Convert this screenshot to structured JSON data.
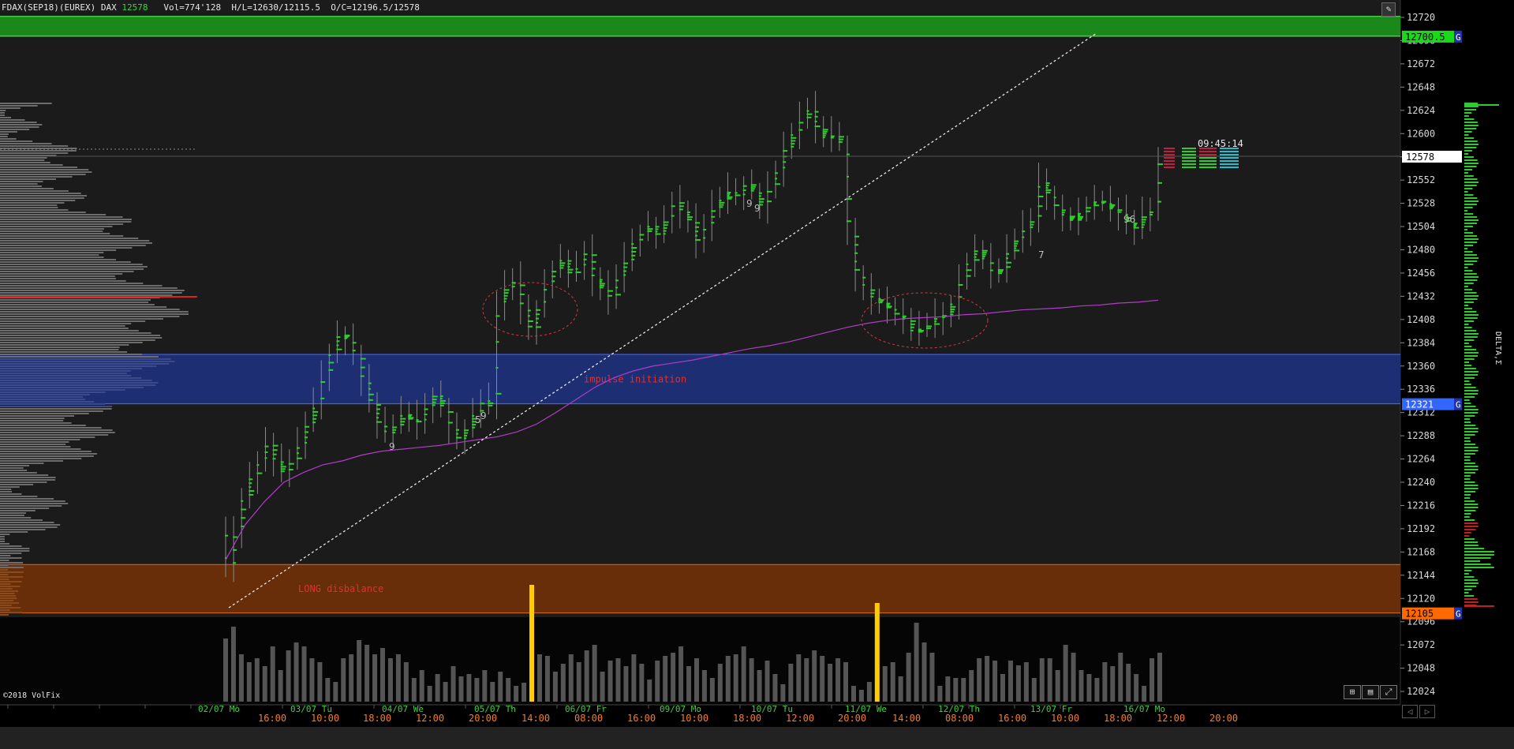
{
  "header": {
    "symbol": "FDAX(SEP18)(EUREX) DAX",
    "last": "12578",
    "stats": "Vol=774'128  H/L=12630/12115.5  O/C=12196.5/12578"
  },
  "copyright": "©2018 VolFix",
  "delta_label": "DELTA,Σ",
  "clock": "09:45:14",
  "price_tag": "12578",
  "zones": [
    {
      "name": "upper-supply",
      "from": 12700.5,
      "to": 12721,
      "color": "#1a8f1a",
      "edge": "#5cff5c",
      "label": "",
      "tag": "12700.5",
      "tag_bg": "#1ad81a",
      "tag_fg": "#000"
    },
    {
      "name": "impulse-initiation",
      "from": 12321,
      "to": 12372,
      "color": "#1e2f78",
      "edge": "#4a6aff",
      "label": "impulse initiation",
      "tag": "12321",
      "tag_bg": "#3366ff",
      "tag_fg": "#fff"
    },
    {
      "name": "long-disbalance",
      "from": 12105,
      "to": 12155,
      "color": "#6b2f08",
      "edge": "#e26a12",
      "label": "LONG disbalance",
      "tag": "12105",
      "tag_bg": "#ff6a00",
      "tag_fg": "#000"
    }
  ],
  "colors": {
    "background": "#1b1b1b",
    "axis_bg": "#000",
    "price_tick": "#d9d9d9",
    "date_label": "#3cd23c",
    "time_label": "#ff7a1a",
    "candle": "#8a8a8a",
    "cluster": "#2ecc2e",
    "vwap": "#b03cc8",
    "trendline": "#e6e6e6",
    "ellipse": "#d63a3a",
    "volume": "#555",
    "volume_hi": "#ffcc00",
    "profile": "#6c6c6c",
    "poc": "#e02020"
  },
  "chart_data": {
    "type": "candlestick",
    "title": "",
    "y_ticks": [
      12720,
      12696,
      12672,
      12648,
      12624,
      12600,
      12576,
      12552,
      12528,
      12504,
      12480,
      12456,
      12432,
      12408,
      12384,
      12360,
      12336,
      12312,
      12288,
      12264,
      12240,
      12216,
      12192,
      12168,
      12144,
      12120,
      12096,
      12072,
      12048,
      12024
    ],
    "y_tick_labels": [
      "12720",
      "12696",
      "12672",
      "12648",
      "12624",
      "12600",
      "12576",
      "12552",
      "12528",
      "12504",
      "12480",
      "12456",
      "12432",
      "12408",
      "12384",
      "12360",
      "12336",
      "12312",
      "12288",
      "12264",
      "12240",
      "12216",
      "12192",
      "12168",
      "12144",
      "12120",
      "12096",
      "12072",
      "12048",
      "12024"
    ],
    "y_range": [
      12012,
      12728
    ],
    "date_labels": [
      "02/07 Mo",
      "03/07 Tu",
      "04/07 We",
      "05/07 Th",
      "06/07 Fr",
      "09/07 Mo",
      "10/07 Tu",
      "11/07 We",
      "12/07 Th",
      "13/07 Fr",
      "16/07 Mo"
    ],
    "time_labels": [
      "16:00",
      "10:00",
      "18:00",
      "12:00",
      "20:00",
      "14:00",
      "08:00",
      "16:00",
      "10:00",
      "18:00",
      "12:00",
      "20:00",
      "14:00",
      "08:00",
      "16:00",
      "10:00",
      "18:00",
      "12:00",
      "20:00"
    ],
    "closes": [
      12150,
      12190,
      12225,
      12245,
      12262,
      12280,
      12262,
      12250,
      12262,
      12278,
      12300,
      12318,
      12352,
      12375,
      12392,
      12388,
      12372,
      12345,
      12322,
      12300,
      12290,
      12298,
      12310,
      12305,
      12302,
      12318,
      12330,
      12318,
      12296,
      12284,
      12295,
      12310,
      12325,
      12318,
      12425,
      12440,
      12448,
      12420,
      12398,
      12420,
      12445,
      12460,
      12470,
      12455,
      12462,
      12478,
      12450,
      12440,
      12430,
      12452,
      12468,
      12488,
      12498,
      12505,
      12495,
      12510,
      12530,
      12520,
      12510,
      12488,
      12505,
      12523,
      12532,
      12540,
      12535,
      12548,
      12540,
      12525,
      12545,
      12562,
      12585,
      12600,
      12615,
      12625,
      12605,
      12595,
      12598,
      12590,
      12498,
      12455,
      12440,
      12430,
      12425,
      12420,
      12412,
      12408,
      12395,
      12398,
      12402,
      12410,
      12412,
      12425,
      12450,
      12468,
      12480,
      12470,
      12455,
      12460,
      12478,
      12490,
      12502,
      12510,
      12550,
      12538,
      12522,
      12515,
      12510,
      12518,
      12525,
      12530,
      12528,
      12522,
      12518,
      12508,
      12502,
      12515,
      12520,
      12578
    ],
    "vwap": [
      12160,
      12196,
      12220,
      12240,
      12250,
      12258,
      12262,
      12268,
      12272,
      12274,
      12276,
      12278,
      12281,
      12284,
      12287,
      12292,
      12300,
      12312,
      12325,
      12338,
      12348,
      12355,
      12360,
      12363,
      12366,
      12370,
      12374,
      12378,
      12381,
      12385,
      12390,
      12395,
      12400,
      12404,
      12407,
      12409,
      12410,
      12411,
      12413,
      12414,
      12416,
      12418,
      12419,
      12420,
      12422,
      12423,
      12425,
      12426,
      12428
    ],
    "volume": [
      80,
      95,
      60,
      50,
      55,
      45,
      70,
      40,
      65,
      75,
      70,
      55,
      50,
      30,
      25,
      55,
      60,
      78,
      72,
      60,
      68,
      55,
      60,
      50,
      30,
      40,
      20,
      35,
      25,
      45,
      32,
      35,
      30,
      40,
      25,
      38,
      30,
      20,
      24,
      95,
      60,
      58,
      38,
      48,
      60,
      50,
      65,
      72,
      38,
      52,
      55,
      45,
      60,
      48,
      28,
      52,
      58,
      62,
      70,
      45,
      55,
      40,
      30,
      48,
      58,
      60,
      70,
      55,
      40,
      52,
      35,
      22,
      48,
      60,
      55,
      65,
      58,
      48,
      55,
      50,
      20,
      15,
      25,
      80,
      45,
      50,
      32,
      62,
      100,
      75,
      62,
      20,
      32,
      30,
      30,
      40,
      55,
      58,
      52,
      35,
      52,
      46,
      50,
      30,
      55,
      55,
      40,
      72,
      62,
      40,
      35,
      30,
      50,
      45,
      62,
      48,
      35,
      20,
      55,
      62
    ],
    "volume_spikes": [
      39,
      83
    ],
    "annotations": [
      "impulse initiation",
      "LONG disbalance"
    ],
    "bar_labels": [
      "9",
      "5",
      "9",
      "9",
      "9",
      "7",
      "96"
    ]
  }
}
